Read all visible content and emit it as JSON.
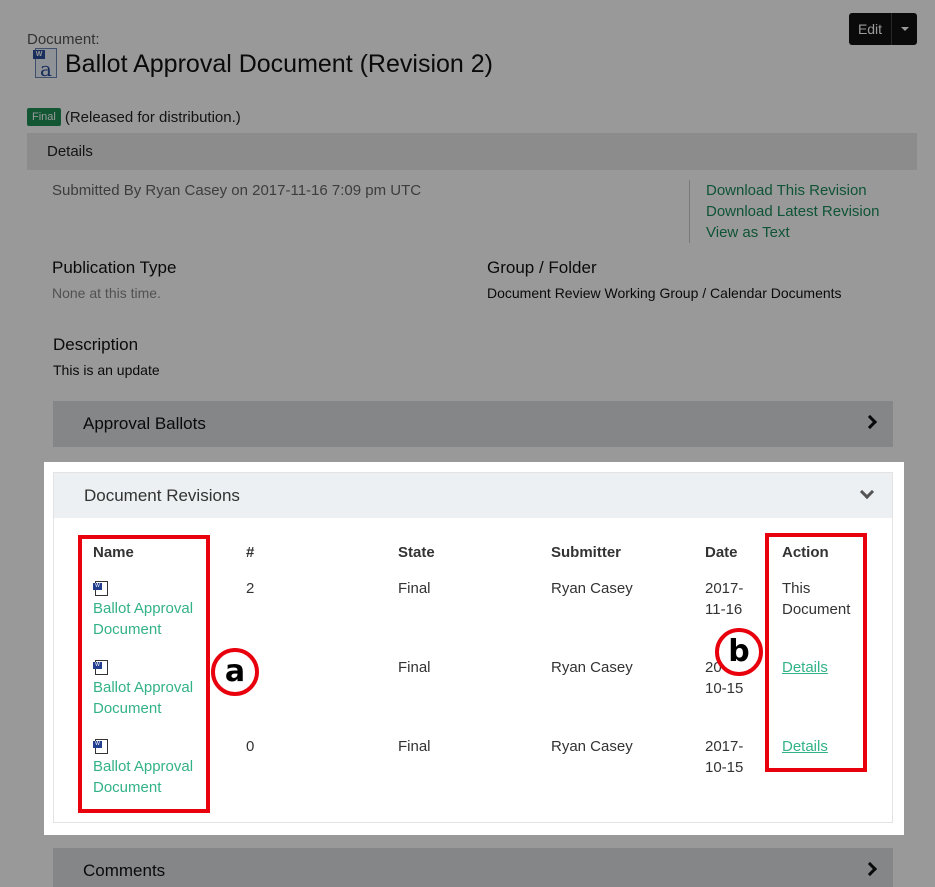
{
  "header": {
    "doc_label": "Document:",
    "title": "Ballot Approval Document (Revision 2)",
    "edit_label": "Edit",
    "state_badge": "Final",
    "state_text": "(Released for distribution.)"
  },
  "details": {
    "bar_label": "Details",
    "submitted": "Submitted By Ryan Casey on 2017-11-16 7:09 pm UTC",
    "links": [
      "Download This Revision",
      "Download Latest Revision",
      "View as Text"
    ],
    "publication_type_label": "Publication Type",
    "publication_type_value": "None at this time.",
    "group_label": "Group / Folder",
    "group_value": "Document Review Working Group / Calendar Documents",
    "description_label": "Description",
    "description_value": "This is an update"
  },
  "panels": {
    "approval_ballots": "Approval Ballots",
    "document_revisions": "Document Revisions",
    "comments": "Comments"
  },
  "revisions": {
    "headers": [
      "Name",
      "#",
      "State",
      "Submitter",
      "Date",
      "Action"
    ],
    "rows": [
      {
        "name_line1": "Ballot Approval",
        "name_line2": "Document",
        "num": "2",
        "state": "Final",
        "submitter": "Ryan Casey",
        "date_line1": "2017-",
        "date_line2": "11-16",
        "action_line1": "This",
        "action_line2": "Document"
      },
      {
        "name_line1": "Ballot Approval",
        "name_line2": "Document",
        "num": "",
        "state": "Final",
        "submitter": "Ryan Casey",
        "date_line1": "20",
        "date_line2": "10-15",
        "action_link": "Details"
      },
      {
        "name_line1": "Ballot Approval",
        "name_line2": "Document",
        "num": "0",
        "state": "Final",
        "submitter": "Ryan Casey",
        "date_line1": "2017-",
        "date_line2": "10-15",
        "action_link": "Details"
      }
    ]
  },
  "callouts": {
    "a": "a",
    "b": "b"
  },
  "icons": {
    "file": "word-document-icon",
    "chevron_right": "chevron-right-icon",
    "chevron_down": "chevron-down-icon"
  },
  "colors": {
    "accent_green": "#33b288",
    "link_green": "#1a8c5a",
    "badge_green": "#1e8f58",
    "annotation_red": "#e8000d"
  }
}
